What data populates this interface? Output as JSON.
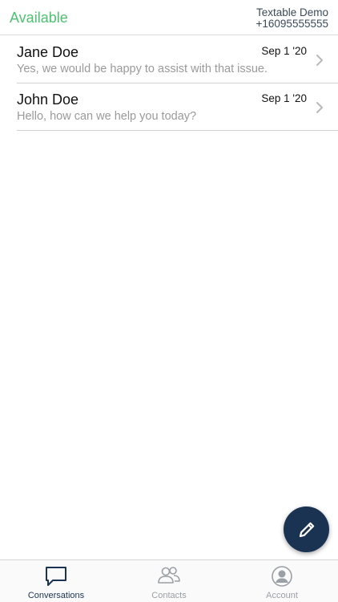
{
  "header": {
    "status": "Available",
    "account_name": "Textable Demo",
    "account_number": "+16095555555"
  },
  "conversations": [
    {
      "name": "Jane Doe",
      "date": "Sep 1 '20",
      "preview": "Yes, we would be happy to assist with that issue."
    },
    {
      "name": "John Doe",
      "date": "Sep 1 '20",
      "preview": "Hello, how can we help you today?"
    }
  ],
  "tabs": {
    "conversations": "Conversations",
    "contacts": "Contacts",
    "account": "Account"
  },
  "colors": {
    "status": "#4cc36e",
    "brand": "#1b3352",
    "muted": "#9aa0a6"
  },
  "icons": {
    "fab": "pencil-icon",
    "tab_conversations": "chat-bubble-icon",
    "tab_contacts": "people-icon",
    "tab_account": "person-circle-icon"
  }
}
